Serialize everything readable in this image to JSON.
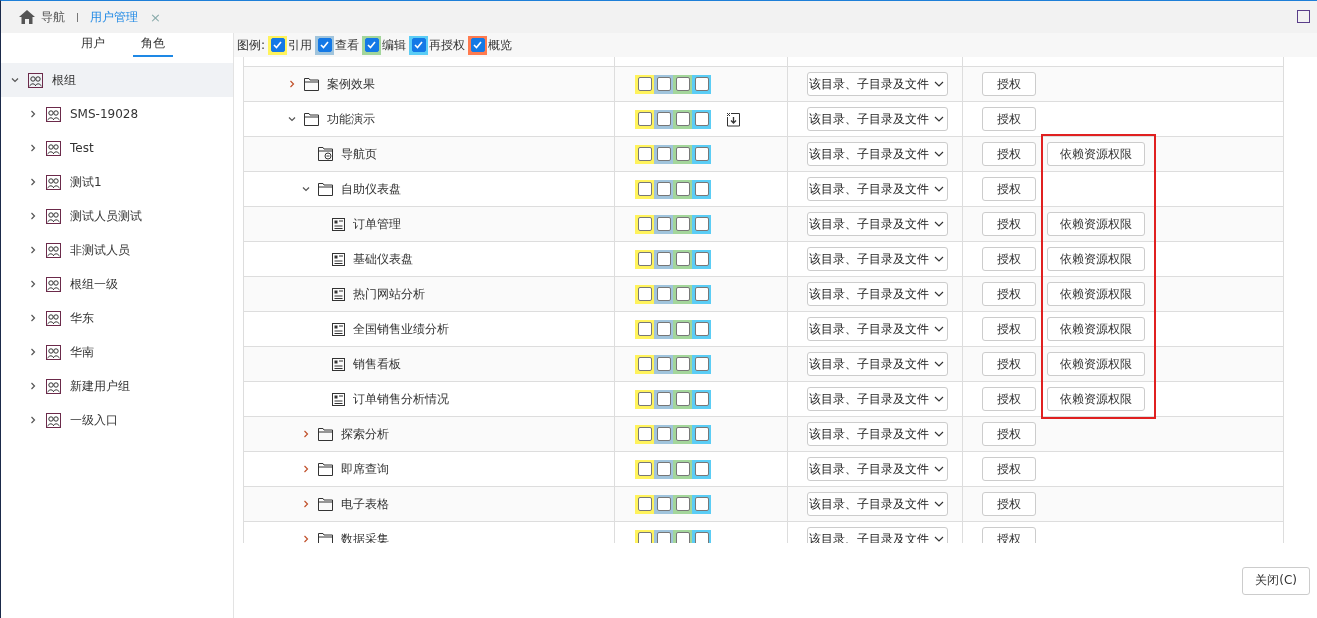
{
  "nav_tabs": [
    {
      "label": "导航",
      "kind": "home",
      "selected": false
    },
    {
      "label": "用户管理",
      "kind": "closable",
      "selected": true,
      "close": "×"
    }
  ],
  "sidebar": {
    "tabs": [
      {
        "label": "用户",
        "selected": false
      },
      {
        "label": "角色",
        "selected": true
      }
    ],
    "tree": [
      {
        "label": "根组",
        "expanded": true,
        "selected": true,
        "children": [
          {
            "label": "SMS-19028",
            "expanded": false,
            "selected": false
          },
          {
            "label": "Test",
            "expanded": false,
            "selected": false
          },
          {
            "label": "测试1",
            "expanded": false,
            "selected": false
          },
          {
            "label": "测试人员测试",
            "expanded": false,
            "selected": false
          },
          {
            "label": "非测试人员",
            "expanded": false,
            "selected": false
          },
          {
            "label": "根组一级",
            "expanded": false,
            "selected": false
          },
          {
            "label": "华东",
            "expanded": false,
            "selected": false
          },
          {
            "label": "华南",
            "expanded": false,
            "selected": false
          },
          {
            "label": "新建用户组",
            "expanded": false,
            "selected": false
          },
          {
            "label": "一级入口",
            "expanded": false,
            "selected": false
          }
        ]
      }
    ]
  },
  "legend": {
    "title": "图例:",
    "items": [
      {
        "label": "引用",
        "color": "#fff35c",
        "checked": true
      },
      {
        "label": "查看",
        "color": "#a0c4dc",
        "checked": true
      },
      {
        "label": "编辑",
        "color": "#a3d69b",
        "checked": true
      },
      {
        "label": "再授权",
        "color": "#5bcdf5",
        "checked": true
      },
      {
        "label": "概览",
        "color": "#ff7b4f",
        "checked": true
      }
    ]
  },
  "table": {
    "rows": [
      {
        "name": "案例效果",
        "kind": "folder",
        "expanded": false,
        "checks": [
          {
            "checked": false
          },
          {
            "checked": false
          },
          {
            "checked": false
          },
          {
            "checked": false
          }
        ],
        "scope": "该目录、子目录及文件",
        "grant": "授权"
      },
      {
        "name": "功能演示",
        "kind": "folder",
        "expanded": true,
        "checks": [
          {
            "checked": false
          },
          {
            "checked": false
          },
          {
            "checked": false
          },
          {
            "checked": false
          }
        ],
        "action_icon": true,
        "scope": "该目录、子目录及文件",
        "grant": "授权",
        "children": [
          {
            "name": "导航页",
            "kind": "page",
            "checks": [
              {
                "checked": false
              },
              {
                "checked": false
              },
              {
                "checked": false
              },
              {
                "checked": false
              }
            ],
            "scope": "该目录、子目录及文件",
            "grant": "授权",
            "dependency": "依赖资源权限"
          },
          {
            "name": "自助仪表盘",
            "kind": "folder",
            "expanded": true,
            "checks": [
              {
                "checked": false
              },
              {
                "checked": false
              },
              {
                "checked": false
              },
              {
                "checked": false
              }
            ],
            "scope": "该目录、子目录及文件",
            "grant": "授权",
            "children": [
              {
                "name": "订单管理",
                "kind": "dashboard",
                "checks": [
                  {
                    "checked": false
                  },
                  {
                    "checked": false
                  },
                  {
                    "checked": false
                  },
                  {
                    "checked": false
                  }
                ],
                "scope": "该目录、子目录及文件",
                "grant": "授权",
                "dependency": "依赖资源权限"
              },
              {
                "name": "基础仪表盘",
                "kind": "dashboard",
                "checks": [
                  {
                    "checked": false
                  },
                  {
                    "checked": false
                  },
                  {
                    "checked": false
                  },
                  {
                    "checked": false
                  }
                ],
                "scope": "该目录、子目录及文件",
                "grant": "授权",
                "dependency": "依赖资源权限"
              },
              {
                "name": "热门网站分析",
                "kind": "dashboard",
                "checks": [
                  {
                    "checked": false
                  },
                  {
                    "checked": false
                  },
                  {
                    "checked": false
                  },
                  {
                    "checked": false
                  }
                ],
                "scope": "该目录、子目录及文件",
                "grant": "授权",
                "dependency": "依赖资源权限"
              },
              {
                "name": "全国销售业绩分析",
                "kind": "dashboard",
                "checks": [
                  {
                    "checked": false
                  },
                  {
                    "checked": false
                  },
                  {
                    "checked": false
                  },
                  {
                    "checked": false
                  }
                ],
                "scope": "该目录、子目录及文件",
                "grant": "授权",
                "dependency": "依赖资源权限"
              },
              {
                "name": "销售看板",
                "kind": "dashboard",
                "checks": [
                  {
                    "checked": false
                  },
                  {
                    "checked": false
                  },
                  {
                    "checked": false
                  },
                  {
                    "checked": false
                  }
                ],
                "scope": "该目录、子目录及文件",
                "grant": "授权",
                "dependency": "依赖资源权限"
              },
              {
                "name": "订单销售分析情况",
                "kind": "dashboard",
                "checks": [
                  {
                    "checked": false
                  },
                  {
                    "checked": false
                  },
                  {
                    "checked": false
                  },
                  {
                    "checked": false
                  }
                ],
                "scope": "该目录、子目录及文件",
                "grant": "授权",
                "dependency": "依赖资源权限"
              }
            ]
          },
          {
            "name": "探索分析",
            "kind": "folder",
            "expanded": false,
            "checks": [
              {
                "checked": false
              },
              {
                "checked": false
              },
              {
                "checked": false
              },
              {
                "checked": false
              }
            ],
            "scope": "该目录、子目录及文件",
            "grant": "授权"
          },
          {
            "name": "即席查询",
            "kind": "folder",
            "expanded": false,
            "checks": [
              {
                "checked": false
              },
              {
                "checked": false
              },
              {
                "checked": false
              },
              {
                "checked": false
              }
            ],
            "scope": "该目录、子目录及文件",
            "grant": "授权"
          },
          {
            "name": "电子表格",
            "kind": "folder",
            "expanded": false,
            "checks": [
              {
                "checked": false
              },
              {
                "checked": false
              },
              {
                "checked": false
              },
              {
                "checked": false
              }
            ],
            "scope": "该目录、子目录及文件",
            "grant": "授权"
          },
          {
            "name": "数据采集",
            "kind": "folder",
            "expanded": false,
            "checks": [
              {
                "checked": false
              },
              {
                "checked": false
              },
              {
                "checked": false
              },
              {
                "checked": false
              }
            ],
            "scope": "该目录、子目录及文件",
            "grant": "授权"
          }
        ]
      }
    ]
  },
  "close_button": "关闭(C)"
}
